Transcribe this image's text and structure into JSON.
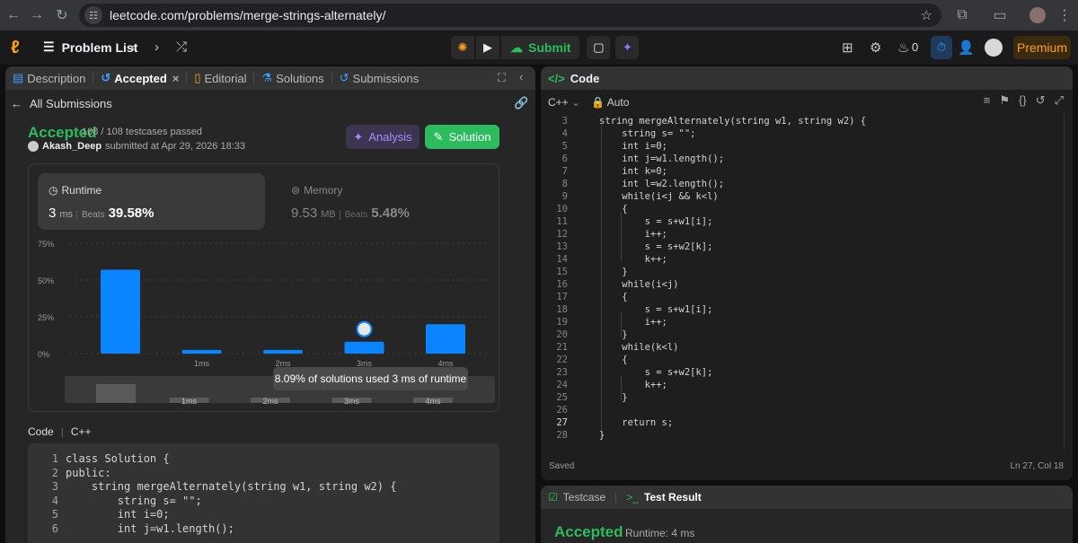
{
  "browser": {
    "url": "leetcode.com/problems/merge-strings-alternately/"
  },
  "topbar": {
    "problem_list": "Problem List",
    "submit": "Submit",
    "streak": "0",
    "premium": "Premium"
  },
  "left_tabs": [
    {
      "label": "Description"
    },
    {
      "label": "Accepted"
    },
    {
      "label": "Editorial"
    },
    {
      "label": "Solutions"
    },
    {
      "label": "Submissions"
    }
  ],
  "submission": {
    "back_label": "All Submissions",
    "status": "Accepted",
    "passed": "108 / 108 testcases passed",
    "user": "Akash_Deep",
    "submitted_at": "submitted at Apr 29, 2026 18:33",
    "analysis_label": "Analysis",
    "solution_label": "Solution"
  },
  "runtime": {
    "title": "Runtime",
    "value": "3",
    "unit": "ms",
    "beats_label": "Beats",
    "beats": "39.58%"
  },
  "memory": {
    "title": "Memory",
    "value": "9.53",
    "unit": "MB",
    "beats_label": "Beats",
    "beats": "5.48%"
  },
  "chart_data": {
    "type": "bar",
    "y_ticks": [
      "75%",
      "50%",
      "25%",
      "0%"
    ],
    "ylim": [
      0,
      75
    ],
    "categories": [
      "",
      "1ms",
      "2ms",
      "3ms",
      "4ms"
    ],
    "values": [
      57,
      2.5,
      2.5,
      8.09,
      20
    ],
    "tooltip": "8.09% of solutions used 3 ms of runtime",
    "mini_labels": [
      "1ms",
      "2ms",
      "3ms",
      "4ms"
    ],
    "colors": {
      "bar": "#0a84ff",
      "mini": "#5a5a5a"
    }
  },
  "code_section": {
    "label": "Code",
    "lang": "C++"
  },
  "submitted_code": [
    {
      "n": "1",
      "t": "class Solution {"
    },
    {
      "n": "2",
      "t": "public:"
    },
    {
      "n": "3",
      "t": "    string mergeAlternately(string w1, string w2) {"
    },
    {
      "n": "4",
      "t": "        string s= \"\";"
    },
    {
      "n": "5",
      "t": "        int i=0;"
    },
    {
      "n": "6",
      "t": "        int j=w1.length();"
    }
  ],
  "editor": {
    "title": "Code",
    "lang": "C++",
    "mode": "Auto",
    "status": "Saved",
    "cursor": "Ln 27, Col 18",
    "lines": [
      {
        "n": "3",
        "t": "string mergeAlternately(string w1, string w2) {"
      },
      {
        "n": "4",
        "t": "    string s= \"\";"
      },
      {
        "n": "5",
        "t": "    int i=0;"
      },
      {
        "n": "6",
        "t": "    int j=w1.length();"
      },
      {
        "n": "7",
        "t": "    int k=0;"
      },
      {
        "n": "8",
        "t": "    int l=w2.length();"
      },
      {
        "n": "9",
        "t": "    while(i<j && k<l)"
      },
      {
        "n": "10",
        "t": "    {"
      },
      {
        "n": "11",
        "t": "        s = s+w1[i];"
      },
      {
        "n": "12",
        "t": "        i++;"
      },
      {
        "n": "13",
        "t": "        s = s+w2[k];"
      },
      {
        "n": "14",
        "t": "        k++;"
      },
      {
        "n": "15",
        "t": "    }"
      },
      {
        "n": "16",
        "t": "    while(i<j)"
      },
      {
        "n": "17",
        "t": "    {"
      },
      {
        "n": "18",
        "t": "        s = s+w1[i];"
      },
      {
        "n": "19",
        "t": "        i++;"
      },
      {
        "n": "20",
        "t": "    }"
      },
      {
        "n": "21",
        "t": "    while(k<l)"
      },
      {
        "n": "22",
        "t": "    {"
      },
      {
        "n": "23",
        "t": "        s = s+w2[k];"
      },
      {
        "n": "24",
        "t": "        k++;"
      },
      {
        "n": "25",
        "t": "    }"
      },
      {
        "n": "26",
        "t": ""
      },
      {
        "n": "27",
        "t": "    return s;"
      },
      {
        "n": "28",
        "t": "}"
      }
    ]
  },
  "bottom": {
    "testcase": "Testcase",
    "test_result": "Test Result",
    "status": "Accepted",
    "runtime": "Runtime: 4 ms"
  }
}
